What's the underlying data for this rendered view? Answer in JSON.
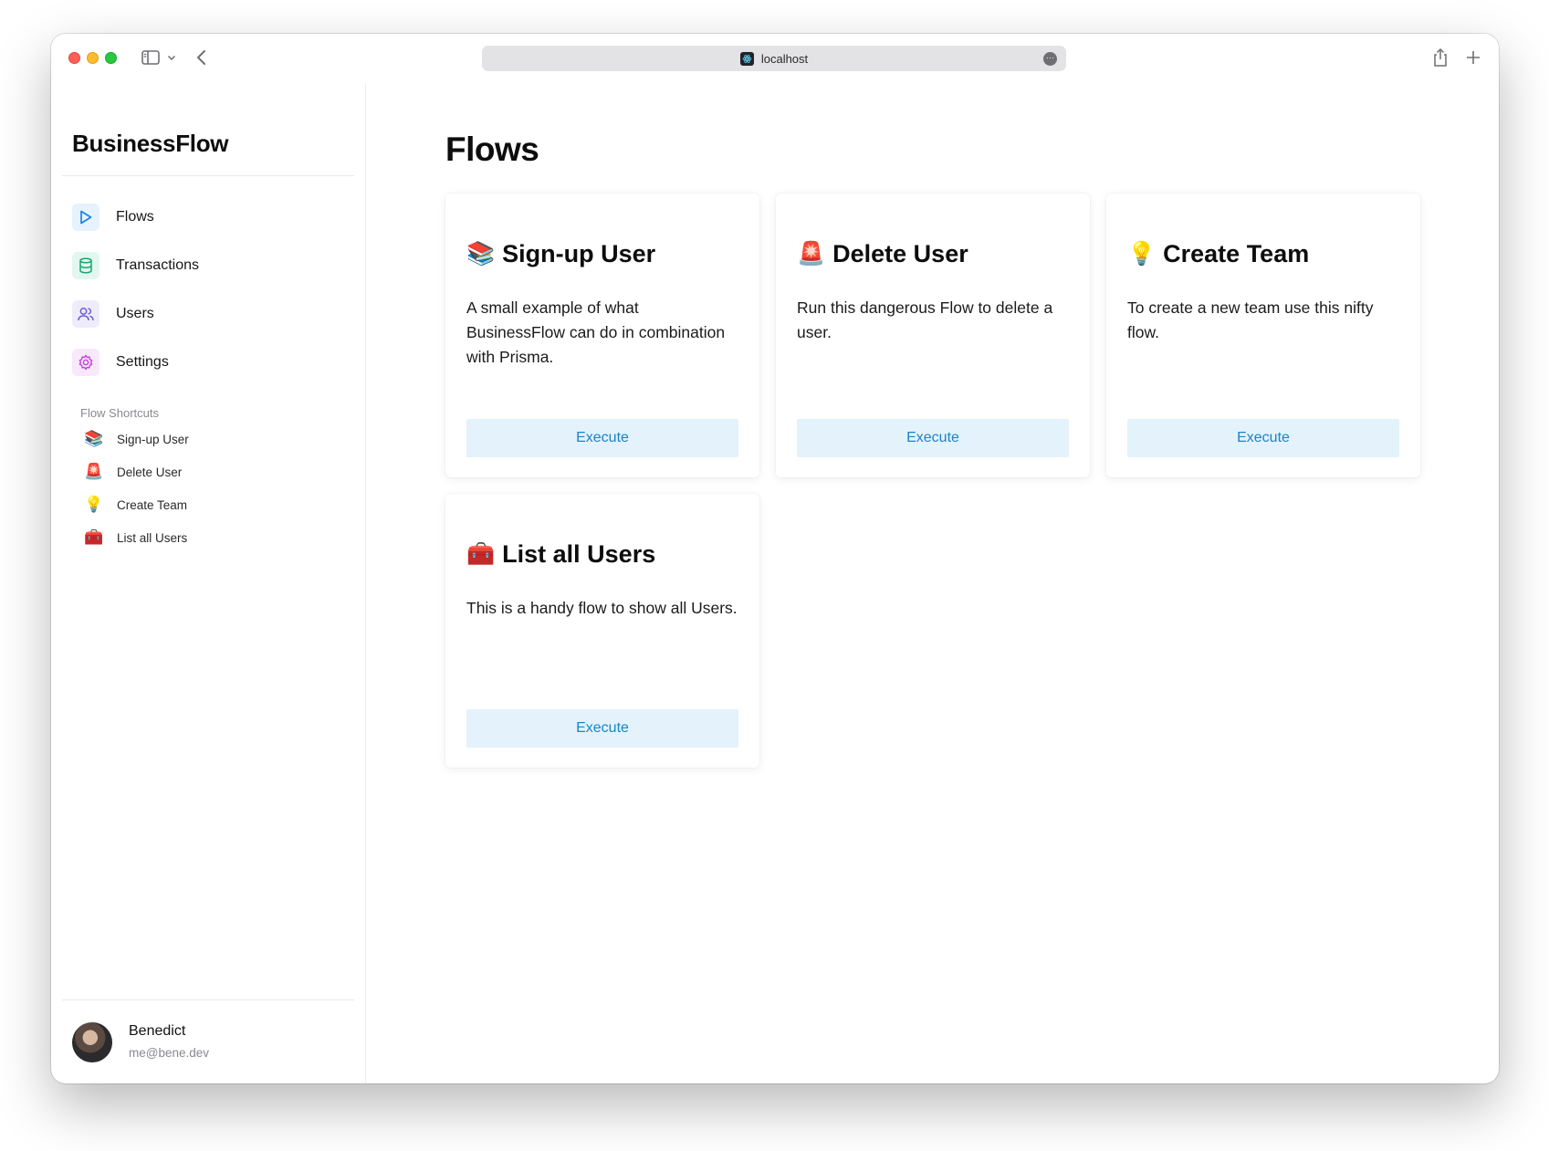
{
  "browser": {
    "url": "localhost",
    "more_label": "···"
  },
  "sidebar": {
    "brand": "BusinessFlow",
    "nav": [
      {
        "label": "Flows",
        "icon": "play-icon",
        "color": "#1a84e8"
      },
      {
        "label": "Transactions",
        "icon": "database-icon",
        "color": "#15a874"
      },
      {
        "label": "Users",
        "icon": "users-icon",
        "color": "#6b5bd6"
      },
      {
        "label": "Settings",
        "icon": "gear-icon",
        "color": "#c046d8"
      }
    ],
    "shortcuts_title": "Flow Shortcuts",
    "shortcuts": [
      {
        "emoji": "📚",
        "label": "Sign-up User"
      },
      {
        "emoji": "🚨",
        "label": "Delete User"
      },
      {
        "emoji": "💡",
        "label": "Create Team"
      },
      {
        "emoji": "🧰",
        "label": "List all Users"
      }
    ],
    "user": {
      "name": "Benedict",
      "email": "me@bene.dev"
    }
  },
  "main": {
    "title": "Flows",
    "flows": [
      {
        "emoji": "📚",
        "title": "Sign-up User",
        "description": "A small example of what BusinessFlow can do in combination with Prisma.",
        "button": "Execute"
      },
      {
        "emoji": "🚨",
        "title": "Delete User",
        "description": "Run this dangerous Flow to delete a user.",
        "button": "Execute"
      },
      {
        "emoji": "💡",
        "title": "Create Team",
        "description": "To create a new team use this nifty flow.",
        "button": "Execute"
      },
      {
        "emoji": "🧰",
        "title": "List all Users",
        "description": "This is a handy flow to show all Users.",
        "button": "Execute"
      }
    ]
  },
  "colors": {
    "accent": "#1a84c8",
    "button_bg": "#e4f2fc"
  }
}
